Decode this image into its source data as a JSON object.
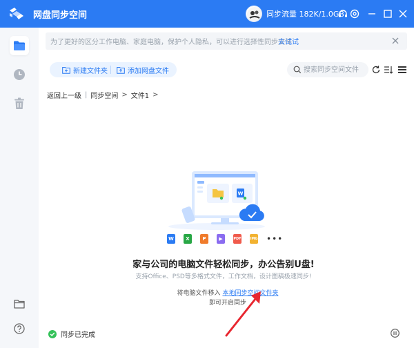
{
  "app": {
    "title": "网盘同步空间",
    "accent": "#2b7bf3"
  },
  "titlebar": {
    "traffic": "同步流量 182K/1.0GB"
  },
  "notice": {
    "text": "为了更好的区分工作电脑、家庭电脑，保护个人隐私，可以进行选择性同步文件",
    "link": "去试试"
  },
  "toolbar": {
    "new_folder": "新建文件夹",
    "add_cloud_file": "添加网盘文件"
  },
  "search": {
    "placeholder": "搜索同步空间文件"
  },
  "breadcrumb": {
    "back": "返回上一级",
    "items": [
      "同步空间",
      "文件1"
    ]
  },
  "empty_state": {
    "headline": "家与公司的电脑文件轻松同步，办公告别U盘!",
    "subtext": "支持Office、PSD等多格式文件，工作文档，设计图稿极速同步!",
    "move_prefix": "将电脑文件移入",
    "move_link": "本地同步空间文件夹",
    "open_line": "即可开启同步",
    "file_types": [
      "W",
      "X",
      "P",
      "▶",
      "PDF",
      "IMG"
    ],
    "file_colors": [
      "#2b7bf3",
      "#28a745",
      "#f07b2b",
      "#8a6cf0",
      "#f05a4b",
      "#f2b230"
    ]
  },
  "status": {
    "text": "同步已完成",
    "color": "#35c25a"
  },
  "icons": {
    "sidebar": [
      "folder-icon",
      "history-icon",
      "trash-icon",
      "local-folder-icon",
      "help-icon"
    ],
    "titlebar": [
      "headset-icon",
      "settings-icon",
      "minimize-icon",
      "maximize-icon",
      "close-icon"
    ]
  }
}
